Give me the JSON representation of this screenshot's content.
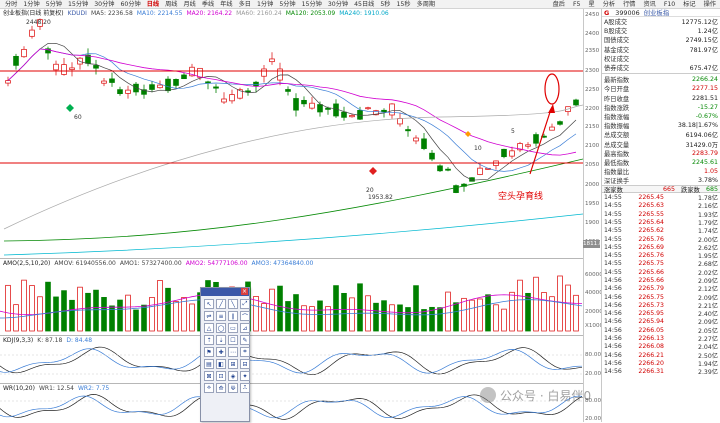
{
  "toolbar": {
    "periods": [
      "分时",
      "1分钟",
      "5分钟",
      "15分钟",
      "30分钟",
      "60分钟",
      "日线",
      "周线",
      "月线",
      "季线",
      "年线",
      "多日",
      "1分钟",
      "5分钟",
      "15分钟",
      "30分钟",
      "45日线",
      "5秒",
      "15秒",
      "多周期"
    ],
    "active_period": "日线",
    "right_buttons": [
      "盘后",
      "F5",
      "星",
      "分析",
      "行情",
      "资讯",
      "F10",
      "标记",
      "操作"
    ]
  },
  "kline": {
    "info_parts": [
      {
        "text": "创业板指(日线 前复权)",
        "color": "#222"
      },
      {
        "text": "KDUDI",
        "color": "#3a5aa8"
      },
      {
        "text": "MA5: 2236.58",
        "color": "#444"
      },
      {
        "text": "MA10: 2214.55",
        "color": "#3a7dd6"
      },
      {
        "text": "MA20: 2164.22",
        "color": "#d100d1"
      },
      {
        "text": "MA60: 2160.24",
        "color": "#999999"
      },
      {
        "text": "MA120: 2053.09",
        "color": "#078a07"
      },
      {
        "text": "MA240: 1910.06",
        "color": "#00a8c8"
      }
    ],
    "high_label": "2448.20",
    "low_label": "1953.82",
    "ma_labels": [
      "60",
      "20",
      "10",
      "5"
    ],
    "y_ticks": [
      "2450",
      "2400",
      "2350",
      "2300",
      "2250",
      "2200",
      "2150",
      "2100",
      "2050",
      "2000",
      "1950",
      "1900",
      "1850"
    ],
    "current_box": "1811.8",
    "annotation": "空头孕育线"
  },
  "amo": {
    "info_parts": [
      {
        "text": "AMO(2,5,10,20)",
        "color": "#222"
      },
      {
        "text": "AMOV: 61940556.00",
        "color": "#444"
      },
      {
        "text": "AMO1: 57327400.00",
        "color": "#444"
      },
      {
        "text": "AMO2: 54777106.00",
        "color": "#d100d1"
      },
      {
        "text": "AMO3: 47364840.00",
        "color": "#3a7dd6"
      }
    ],
    "y_ticks": [
      "60000",
      "40000",
      "20000"
    ],
    "unit": "X1000"
  },
  "kdj": {
    "info_parts": [
      {
        "text": "KDJ(9,3,3)",
        "color": "#222"
      },
      {
        "text": "K: 87.18",
        "color": "#444"
      },
      {
        "text": "D: 84.48",
        "color": "#3a7dd6"
      }
    ],
    "y_ticks": [
      "80.00",
      "20.00"
    ]
  },
  "wr": {
    "info_parts": [
      {
        "text": "WR(10,20)",
        "color": "#222"
      },
      {
        "text": "WR1: 12.54",
        "color": "#444"
      },
      {
        "text": "WR2: 7.75",
        "color": "#3a7dd6"
      }
    ],
    "y_ticks": [
      "80.00",
      "20.00"
    ]
  },
  "watermark": {
    "text": "公众号 · 白易伴0"
  },
  "quote": {
    "code": "399006",
    "name": "创业板指",
    "rows_a": [
      {
        "label": "A股成交",
        "value": "12775.12亿",
        "color": "#222"
      },
      {
        "label": "B股成交",
        "value": "1.24亿",
        "color": "#222"
      },
      {
        "label": "国债成交",
        "value": "2749.15亿",
        "color": "#222"
      },
      {
        "label": "基金成交",
        "value": "781.97亿",
        "color": "#222"
      },
      {
        "label": "权证成交",
        "value": "",
        "color": "#222"
      },
      {
        "label": "债券成交",
        "value": "675.47亿",
        "color": "#222"
      }
    ],
    "rows_b": [
      {
        "label": "最新指数",
        "value": "2266.24",
        "color": "#078a07"
      },
      {
        "label": "今日开盘",
        "value": "2277.15",
        "color": "#d10000"
      },
      {
        "label": "昨日收盘",
        "value": "2281.51",
        "color": "#222"
      },
      {
        "label": "指数涨跌",
        "value": "-15.27",
        "color": "#078a07"
      },
      {
        "label": "指数涨幅",
        "value": "-0.67%",
        "color": "#078a07"
      },
      {
        "label": "指数振幅",
        "value": "38.18|1.67%",
        "color": "#222"
      },
      {
        "label": "总成交额",
        "value": "6194.06亿",
        "color": "#222"
      },
      {
        "label": "总成交量",
        "value": "31429.0万",
        "color": "#222"
      },
      {
        "label": "最高指数",
        "value": "2283.79",
        "color": "#d10000"
      },
      {
        "label": "最低指数",
        "value": "2245.61",
        "color": "#078a07"
      },
      {
        "label": "指数量比",
        "value": "1.05",
        "color": "#d10000"
      },
      {
        "label": "深证换手",
        "value": "3.78%",
        "color": "#222"
      }
    ],
    "ratio": {
      "up_label": "涨家数",
      "up_value": "665",
      "down_label": "跌家数",
      "down_value": "685"
    }
  },
  "ticks": [
    {
      "t": "14:55",
      "p": "2265.45",
      "v": "1.78亿"
    },
    {
      "t": "14:55",
      "p": "2265.63",
      "v": "2.16亿"
    },
    {
      "t": "14:55",
      "p": "2265.55",
      "v": "1.93亿"
    },
    {
      "t": "14:55",
      "p": "2265.64",
      "v": "1.79亿"
    },
    {
      "t": "14:55",
      "p": "2265.62",
      "v": "1.74亿"
    },
    {
      "t": "14:55",
      "p": "2265.76",
      "v": "2.00亿"
    },
    {
      "t": "14:55",
      "p": "2265.69",
      "v": "2.62亿"
    },
    {
      "t": "14:55",
      "p": "2265.76",
      "v": "1.95亿"
    },
    {
      "t": "14:55",
      "p": "2265.75",
      "v": "2.68亿"
    },
    {
      "t": "14:55",
      "p": "2265.66",
      "v": "2.02亿"
    },
    {
      "t": "14:56",
      "p": "2265.66",
      "v": "2.09亿"
    },
    {
      "t": "14:56",
      "p": "2265.79",
      "v": "2.12亿"
    },
    {
      "t": "14:56",
      "p": "2265.75",
      "v": "2.09亿"
    },
    {
      "t": "14:56",
      "p": "2265.73",
      "v": "2.21亿"
    },
    {
      "t": "14:56",
      "p": "2265.95",
      "v": "2.40亿"
    },
    {
      "t": "14:56",
      "p": "2265.94",
      "v": "2.09亿"
    },
    {
      "t": "14:56",
      "p": "2266.05",
      "v": "2.05亿"
    },
    {
      "t": "14:56",
      "p": "2266.13",
      "v": "2.27亿"
    },
    {
      "t": "14:56",
      "p": "2266.08",
      "v": "2.04亿"
    },
    {
      "t": "14:56",
      "p": "2266.21",
      "v": "2.50亿"
    },
    {
      "t": "14:56",
      "p": "2266.20",
      "v": "1.94亿"
    },
    {
      "t": "14:56",
      "p": "2266.31",
      "v": "2.39亿"
    }
  ]
}
